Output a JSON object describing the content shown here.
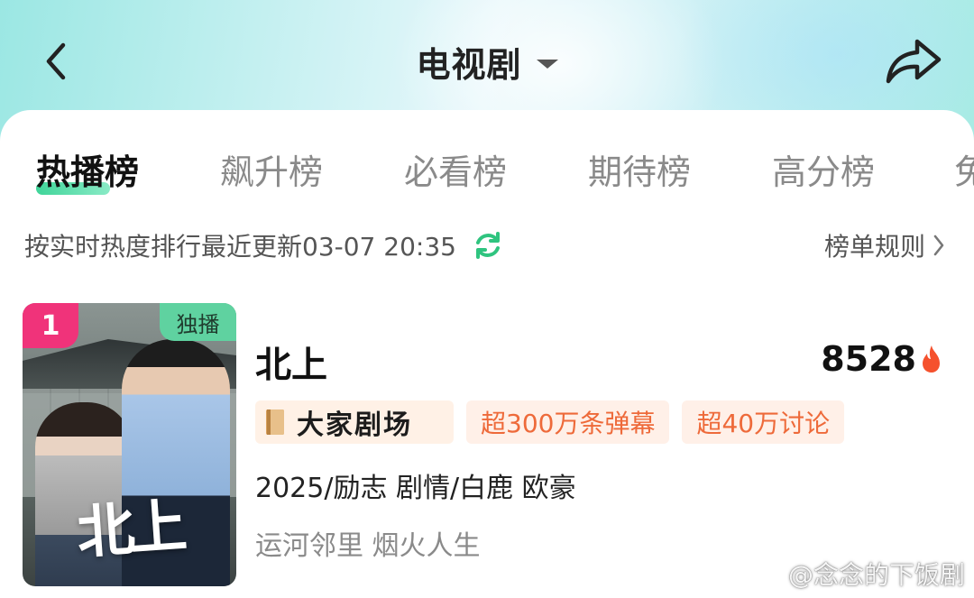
{
  "header": {
    "title": "电视剧"
  },
  "tabs": [
    {
      "label": "热播榜",
      "active": true
    },
    {
      "label": "飙升榜",
      "active": false
    },
    {
      "label": "必看榜",
      "active": false
    },
    {
      "label": "期待榜",
      "active": false
    },
    {
      "label": "高分榜",
      "active": false
    },
    {
      "label": "免",
      "active": false
    }
  ],
  "update": {
    "text": "按实时热度排行最近更新03-07 20:35"
  },
  "rules_link": "榜单规则",
  "item": {
    "rank": "1",
    "badge": "独播",
    "poster_title": "北上",
    "title": "北上",
    "heat": "8528",
    "brand_tag": "大家剧场",
    "tags": [
      "超300万条弹幕",
      "超40万讨论"
    ],
    "meta": "2025/励志 剧情/白鹿 欧豪",
    "slogan": "运河邻里 烟火人生"
  },
  "watermark": "@念念的下饭剧",
  "colors": {
    "accent_green": "#2ad08e",
    "rank_pink": "#f0337a",
    "tag_orange": "#ee6a3a",
    "heat_flame": "#f5512d"
  },
  "icons": {
    "back": "chevron-left-icon",
    "dropdown": "caret-down-icon",
    "share": "share-arrow-icon",
    "refresh": "refresh-icon",
    "rules": "chevron-right-icon",
    "heat": "flame-icon",
    "watermark": "weibo-icon"
  }
}
